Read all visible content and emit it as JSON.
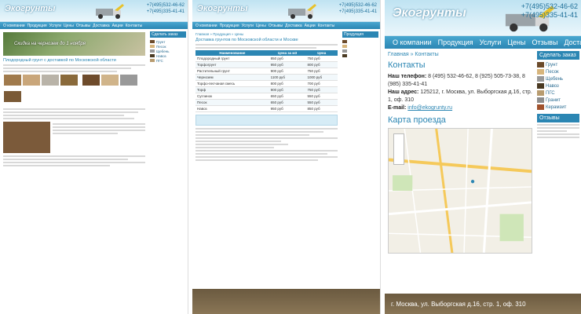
{
  "site": {
    "logo": "Экогрунты",
    "phone1": "+7(495)532-46-62",
    "phone2": "+7(495)335-41-41"
  },
  "nav": [
    "О компании",
    "Продукция",
    "Услуги",
    "Цены",
    "Отзывы",
    "Доставка",
    "Акции",
    "Контакты"
  ],
  "panel1": {
    "banner": "Скидка на чернозем до 1 ноября",
    "heading": "Плодородный грунт с доставкой по Московской области",
    "sidebar_title": "Сделать заказ",
    "sidebar_items": [
      "Грунт",
      "Песок",
      "Щебень",
      "Навоз",
      "ПГС"
    ]
  },
  "panel2": {
    "breadcrumb": "Главная » Продукция » Цены",
    "title": "Доставка грунтов по Московской области и Москве",
    "table_headers": [
      "Наименование",
      "Цена за м3",
      "Цена"
    ],
    "rows": [
      [
        "Плодородный грунт",
        "850 руб",
        "750 руб"
      ],
      [
        "Торфогрунт",
        "950 руб",
        "800 руб"
      ],
      [
        "Растительный грунт",
        "900 руб",
        "750 руб"
      ],
      [
        "Чернозем",
        "1100 руб",
        "1000 руб"
      ],
      [
        "Торфо-песчаная смесь",
        "800 руб",
        "700 руб"
      ],
      [
        "Торф",
        "900 руб",
        "750 руб"
      ],
      [
        "Суглинок",
        "650 руб",
        "550 руб"
      ],
      [
        "Песок",
        "650 руб",
        "550 руб"
      ],
      [
        "Навоз",
        "950 руб",
        "850 руб"
      ]
    ],
    "sidebar_title": "Продукция"
  },
  "panel3": {
    "breadcrumb": "Главная » Контакты",
    "title": "Контакты",
    "phones_label": "Наш телефон:",
    "phones": "8 (495) 532-46-62, 8 (925) 505-73-38, 8 (985) 335-41-41",
    "addr_label": "Наш адрес:",
    "addr": "125212, г. Москва, ул. Выборгская д.16, стр. 1, оф. 310",
    "email_label": "E-mail:",
    "email": "info@ekogrunty.ru",
    "map_title": "Карта проезда",
    "sidebar_title": "Сделать заказ",
    "sidebar_items": [
      "Грунт",
      "Песок",
      "Щебень",
      "Навоз",
      "ПГС",
      "Гранит",
      "Керамзит"
    ],
    "reviews_title": "Отзывы",
    "footer": "г. Москва, ул. Выборгская д.16, стр. 1, оф. 310"
  }
}
